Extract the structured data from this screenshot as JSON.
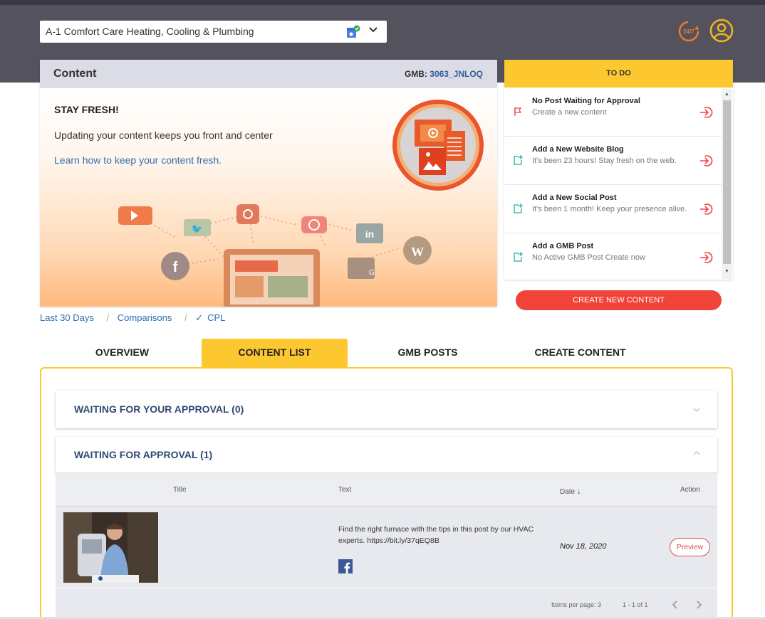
{
  "header": {
    "business_name": "A-1 Comfort Care Heating, Cooling & Plumbing"
  },
  "content_card": {
    "title": "Content",
    "gmb_label": "GMB:",
    "gmb_id": "3063_JNLOQ",
    "heading": "STAY FRESH!",
    "subtext": "Updating your content keeps you front and center",
    "link": "Learn how to keep your content fresh."
  },
  "todo": {
    "title": "TO DO",
    "items": [
      {
        "title": "No Post Waiting for Approval",
        "sub": "Create a new content",
        "icon": "flag-icon"
      },
      {
        "title": "Add a New Website Blog",
        "sub": "It's been 23 hours! Stay fresh on the web.",
        "icon": "add-post-icon"
      },
      {
        "title": "Add a New Social Post",
        "sub": "It's been 1 month! Keep your presence alive.",
        "icon": "add-post-icon"
      },
      {
        "title": "Add a GMB Post",
        "sub": "No Active GMB Post Create now",
        "icon": "add-post-icon"
      }
    ]
  },
  "create_button": "CREATE NEW CONTENT",
  "filters": {
    "range": "Last 30 Days",
    "comparisons": "Comparisons",
    "cpl": "CPL"
  },
  "tabs": [
    "OVERVIEW",
    "CONTENT LIST",
    "GMB POSTS",
    "CREATE CONTENT"
  ],
  "active_tab": "CONTENT LIST",
  "panels": {
    "your_approval": "WAITING FOR YOUR APPROVAL (0)",
    "approval": "WAITING FOR APPROVAL (1)"
  },
  "table": {
    "columns": [
      "Title",
      "Text",
      "Date",
      "Action"
    ],
    "rows": [
      {
        "text": "Find the right furnace with the tips in this post by our HVAC experts. https://bit.ly/37qEQ8B",
        "date": "Nov 18, 2020",
        "action": "Preview",
        "platform": "facebook-icon"
      }
    ],
    "items_per_page": "Items per page: 3",
    "range": "1 - 1 of 1"
  },
  "colors": {
    "header_bg": "#54535d",
    "accent_yellow": "#fdc72f",
    "accent_red": "#f0433a",
    "link_blue": "#2f6fb0",
    "panel_title": "#2e4a72"
  }
}
